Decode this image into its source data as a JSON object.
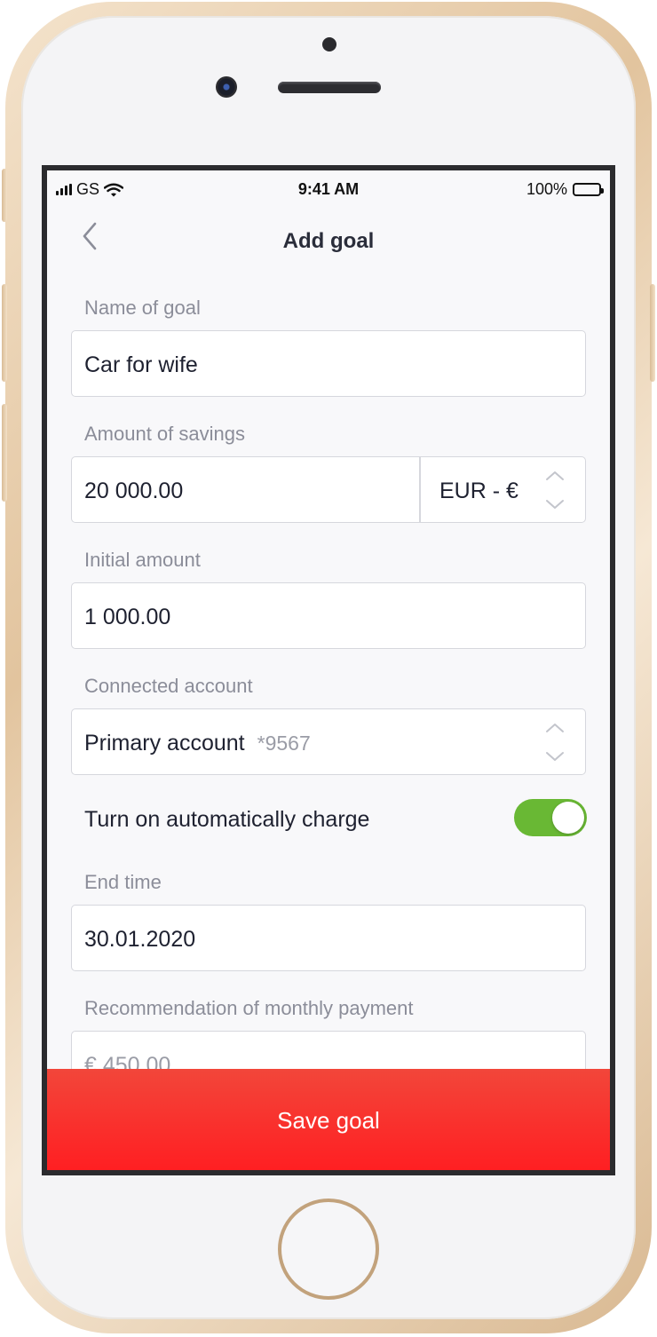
{
  "status_bar": {
    "carrier": "GS",
    "time": "9:41 AM",
    "battery": "100%"
  },
  "header": {
    "title": "Add goal"
  },
  "form": {
    "name_label": "Name of goal",
    "name_value": "Car for wife",
    "amount_label": "Amount of savings",
    "amount_value": "20 000.00",
    "currency_value": "EUR - €",
    "initial_label": "Initial amount",
    "initial_value": "1 000.00",
    "account_label": "Connected account",
    "account_value": "Primary account",
    "account_number": "*9567",
    "auto_charge_label": "Turn on automatically charge",
    "auto_charge_on": true,
    "end_time_label": "End time",
    "end_time_value": "30.01.2020",
    "recommendation_label": "Recommendation of monthly payment",
    "recommendation_value": "€ 450.00"
  },
  "actions": {
    "save_label": "Save goal"
  },
  "colors": {
    "toggle_on": "#69b834",
    "save_button": "#ff2424"
  }
}
